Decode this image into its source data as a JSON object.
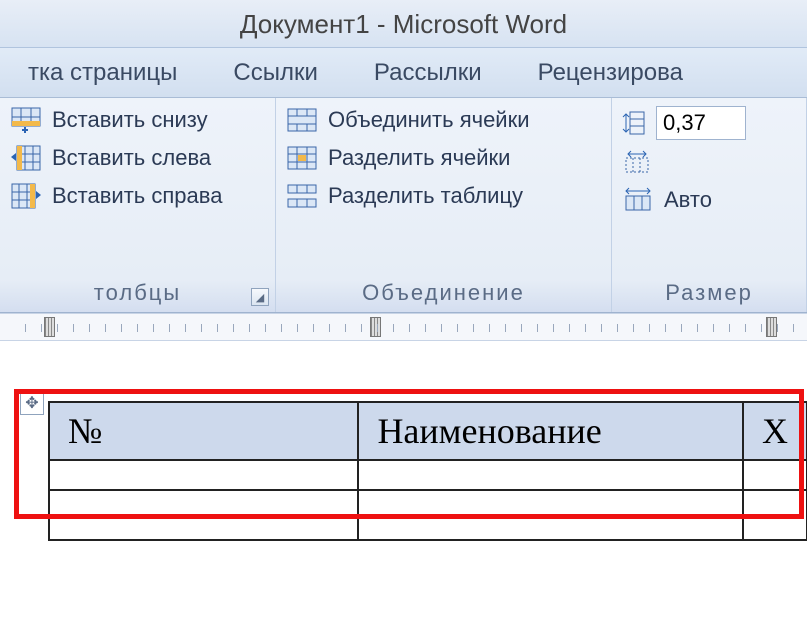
{
  "title": "Документ1  -  Microsoft Word",
  "tabs": {
    "t0": "тка страницы",
    "t1": "Ссылки",
    "t2": "Рассылки",
    "t3": "Рецензирова"
  },
  "group_insert": {
    "b0": "Вставить снизу",
    "b1": "Вставить слева",
    "b2": "Вставить справа",
    "label": "толбцы"
  },
  "group_merge": {
    "b0": "Объединить ячейки",
    "b1": "Разделить ячейки",
    "b2": "Разделить таблицу",
    "label": "Объединение"
  },
  "group_size": {
    "height": "0,37",
    "auto": "Авто",
    "label": "Размер "
  },
  "table": {
    "c0": "№",
    "c1": "Наименование",
    "c2": "Х"
  }
}
